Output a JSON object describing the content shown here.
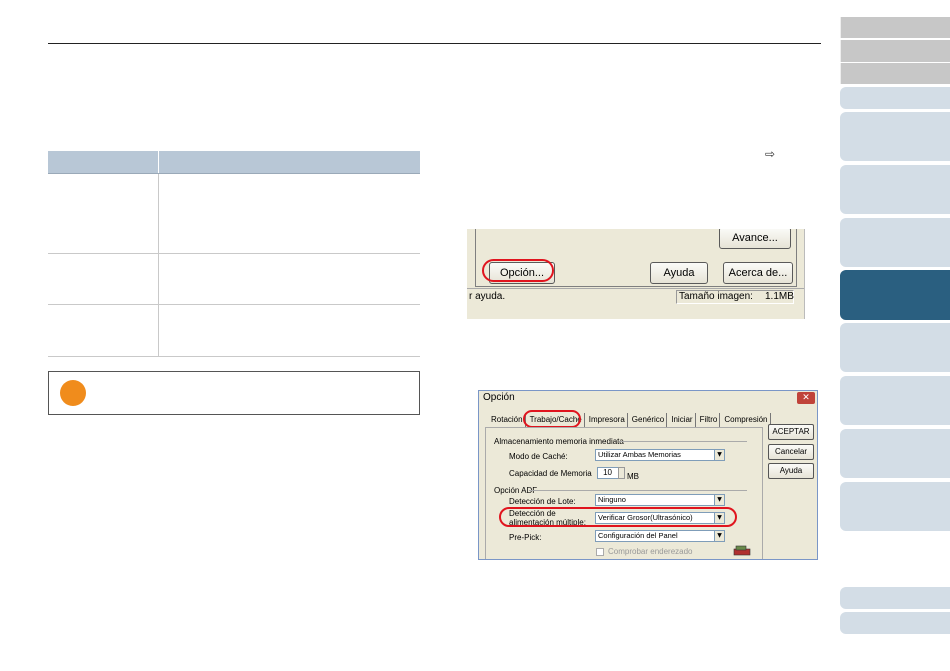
{
  "screenshot1": {
    "avance_label": "Avance...",
    "opcion_label": "Opción...",
    "ayuda_label": "Ayuda",
    "acerca_label": "Acerca de...",
    "status_left": "r ayuda.",
    "image_size_label": "Tamaño imagen:",
    "image_size_value": "1.1MB"
  },
  "dialog": {
    "title": "Opción",
    "close_glyph": "✕",
    "tabs": [
      "Rotación",
      "Trabajo/Caché",
      "Impresora",
      "Genérico",
      "Iniciar",
      "Filtro",
      "Compresión"
    ],
    "section_memory": "Almacenamiento memoria inmediata",
    "cache_mode_label": "Modo de Caché:",
    "cache_mode_value": "Utilizar Ambas Memorias",
    "memory_capacity_label": "Capacidad de Memoria",
    "memory_capacity_value": "10",
    "memory_unit": "MB",
    "section_adf": "Opción ADF",
    "batch_detection_label": "Detección de Lote:",
    "batch_detection_value": "Ninguno",
    "multifeed_label_line1": "Detección de",
    "multifeed_label_line2": "alimentación múltiple:",
    "multifeed_value": "Verificar Grosor(Ultrasónico)",
    "prepick_label": "Pre-Pick:",
    "prepick_value": "Configuración del Panel",
    "check_skew_label": "Comprobar enderezado",
    "ok_button": "ACEPTAR",
    "cancel_button": "Cancelar",
    "help_button": "Ayuda"
  },
  "arrow_glyph": "⇨",
  "colors": {
    "accent_red": "#e0141e",
    "note_orange": "#f08c1c",
    "table_header": "#b8c7d6",
    "sidebar_active": "#2a5f80"
  }
}
